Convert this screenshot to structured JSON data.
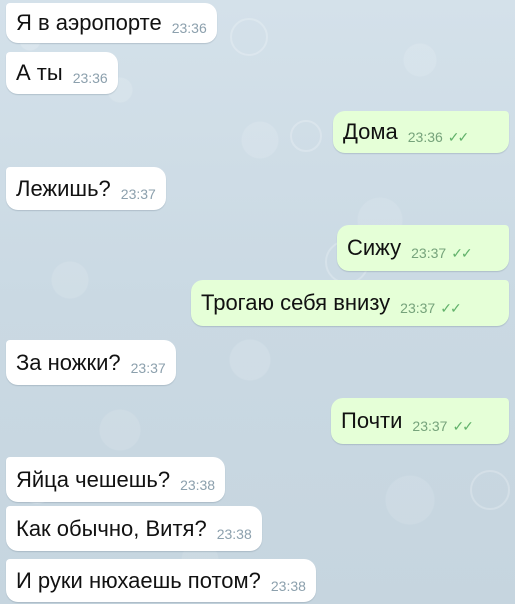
{
  "chat": {
    "messages": [
      {
        "direction": "incoming",
        "text": "Я в аэропорте",
        "time": "23:36"
      },
      {
        "direction": "incoming",
        "text": "А ты",
        "time": "23:36"
      },
      {
        "direction": "outgoing",
        "text": "Дома",
        "time": "23:36",
        "read_icon": "double-check-icon"
      },
      {
        "direction": "incoming",
        "text": "Лежишь?",
        "time": "23:37"
      },
      {
        "direction": "outgoing",
        "text": "Сижу",
        "time": "23:37",
        "read_icon": "double-check-icon"
      },
      {
        "direction": "outgoing",
        "text": "Трогаю себя внизу",
        "time": "23:37",
        "read_icon": "double-check-icon"
      },
      {
        "direction": "incoming",
        "text": "За ножки?",
        "time": "23:37"
      },
      {
        "direction": "outgoing",
        "text": "Почти",
        "time": "23:37",
        "read_icon": "double-check-icon"
      },
      {
        "direction": "incoming",
        "text": "Яйца чешешь?",
        "time": "23:38"
      },
      {
        "direction": "incoming",
        "text": "Как обычно, Витя?",
        "time": "23:38"
      },
      {
        "direction": "incoming",
        "text": "И руки нюхаешь потом?",
        "time": "23:38"
      }
    ],
    "colors": {
      "background": "#cfdde6",
      "incoming_bubble": "#ffffff",
      "outgoing_bubble": "#e5ffd7",
      "read_check": "#62b26b"
    }
  }
}
